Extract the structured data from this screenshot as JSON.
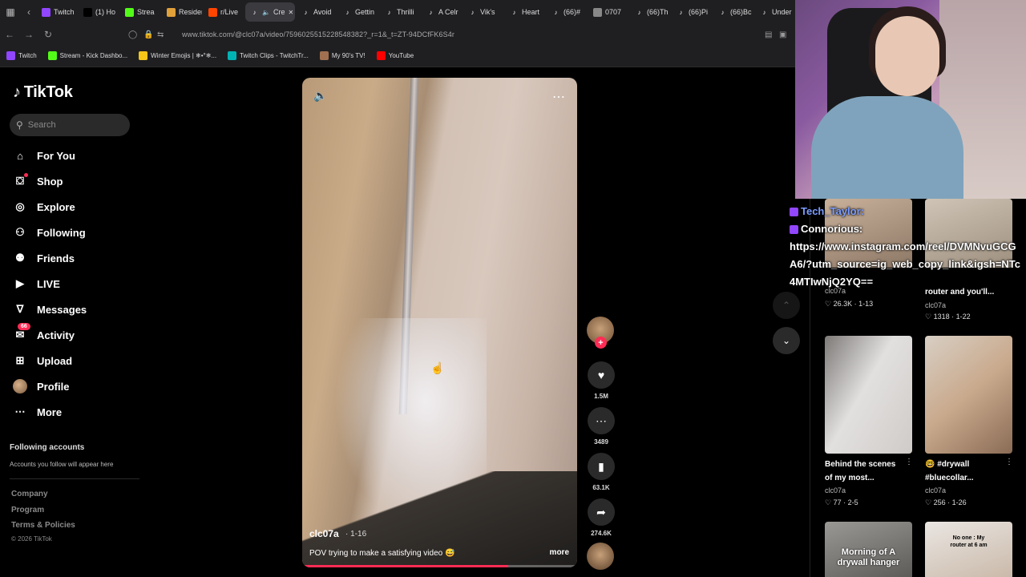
{
  "browser": {
    "tabs": [
      {
        "label": "Twitch",
        "icon": "twitch-icon",
        "color": "#9146ff"
      },
      {
        "label": "(1) Ho",
        "icon": "x-icon",
        "color": "#000000"
      },
      {
        "label": "Strea",
        "icon": "kick-icon",
        "color": "#53fc18"
      },
      {
        "label": "Resident E",
        "icon": "page-icon",
        "color": "#e0a03a"
      },
      {
        "label": "r/Live",
        "icon": "reddit-icon",
        "color": "#ff4500"
      },
      {
        "label": "Cre",
        "icon": "tiktok-icon",
        "color": "#ffffff",
        "active": true
      },
      {
        "label": "Avoid",
        "icon": "tiktok-icon",
        "color": "#ffffff"
      },
      {
        "label": "Gettin",
        "icon": "tiktok-icon",
        "color": "#ffffff"
      },
      {
        "label": "Thrilli",
        "icon": "tiktok-icon",
        "color": "#ffffff"
      },
      {
        "label": "A Celr",
        "icon": "tiktok-icon",
        "color": "#ffffff"
      },
      {
        "label": "Vik's",
        "icon": "tiktok-icon",
        "color": "#ffffff"
      },
      {
        "label": "Heart",
        "icon": "tiktok-icon",
        "color": "#ffffff"
      },
      {
        "label": "(66)#",
        "icon": "tiktok-icon",
        "color": "#ffffff"
      },
      {
        "label": "0707",
        "icon": "page-icon",
        "color": "#888888"
      },
      {
        "label": "(66)Th",
        "icon": "tiktok-icon",
        "color": "#ffffff"
      },
      {
        "label": "(66)Pi",
        "icon": "tiktok-icon",
        "color": "#ffffff"
      },
      {
        "label": "(66)Bc",
        "icon": "tiktok-icon",
        "color": "#ffffff"
      },
      {
        "label": "Under",
        "icon": "tiktok-icon",
        "color": "#ffffff"
      }
    ],
    "url": "www.tiktok.com/@clc07a/video/7596025515228548382?_r=1&_t=ZT-94DCfFK6S4r",
    "bookmarks": [
      {
        "label": "Twitch",
        "color": "#9146ff"
      },
      {
        "label": "Stream - Kick Dashbo...",
        "color": "#53fc18"
      },
      {
        "label": "Winter Emojis | ❄•°❄...",
        "color": "#f5c518"
      },
      {
        "label": "Twitch Clips - TwitchTr...",
        "color": "#00b3b3"
      },
      {
        "label": "My 90's TV!",
        "color": "#a07050"
      },
      {
        "label": "YouTube",
        "color": "#ff0000"
      }
    ]
  },
  "tiktok": {
    "logo": "TikTok",
    "search_placeholder": "Search",
    "nav": [
      {
        "label": "For You",
        "icon": "home-icon"
      },
      {
        "label": "Shop",
        "icon": "shop-icon"
      },
      {
        "label": "Explore",
        "icon": "compass-icon"
      },
      {
        "label": "Following",
        "icon": "following-icon"
      },
      {
        "label": "Friends",
        "icon": "friends-icon"
      },
      {
        "label": "LIVE",
        "icon": "live-icon"
      },
      {
        "label": "Messages",
        "icon": "messages-icon"
      },
      {
        "label": "Activity",
        "icon": "activity-icon",
        "badge": "66"
      },
      {
        "label": "Upload",
        "icon": "upload-icon"
      },
      {
        "label": "Profile",
        "icon": "avatar"
      },
      {
        "label": "More",
        "icon": "more-icon"
      }
    ],
    "following_accounts": {
      "title": "Following accounts",
      "subtitle": "Accounts you follow will appear here"
    },
    "footer": [
      "Company",
      "Program",
      "Terms & Policies"
    ],
    "copyright": "© 2026 TikTok"
  },
  "video": {
    "author": "clc07a",
    "date": "1-16",
    "caption": "POV trying to make a satisfying video 😅",
    "more_label": "more",
    "progress": 0.75,
    "likes": "1.5M",
    "comments": "3489",
    "saves": "63.1K",
    "shares": "274.6K"
  },
  "recommended": [
    {
      "title": "",
      "author": "clc07a",
      "likes": "26.3K",
      "date": "1-13"
    },
    {
      "title": "router and you'll...",
      "author": "clc07a",
      "likes": "1318",
      "date": "1-22"
    },
    {
      "title": "Behind the scenes of my most...",
      "author": "clc07a",
      "likes": "77",
      "date": "2-5"
    },
    {
      "title": "🤓 #drywall #bluecollar...",
      "author": "clc07a",
      "likes": "256",
      "date": "1-26"
    },
    {
      "overlay": "Morning of A drywall hanger"
    },
    {
      "overlay": "No one : My router at 6 am"
    }
  ],
  "chat": {
    "messages": [
      {
        "user": "Tech_Taylor:",
        "text": ""
      },
      {
        "user": "Connorious:",
        "text": "https://www.instagram.com/reel/DVMNvuGCGA6/?utm_source=ig_web_copy_link&igsh=NTc4MTIwNjQ2YQ=="
      }
    ]
  }
}
